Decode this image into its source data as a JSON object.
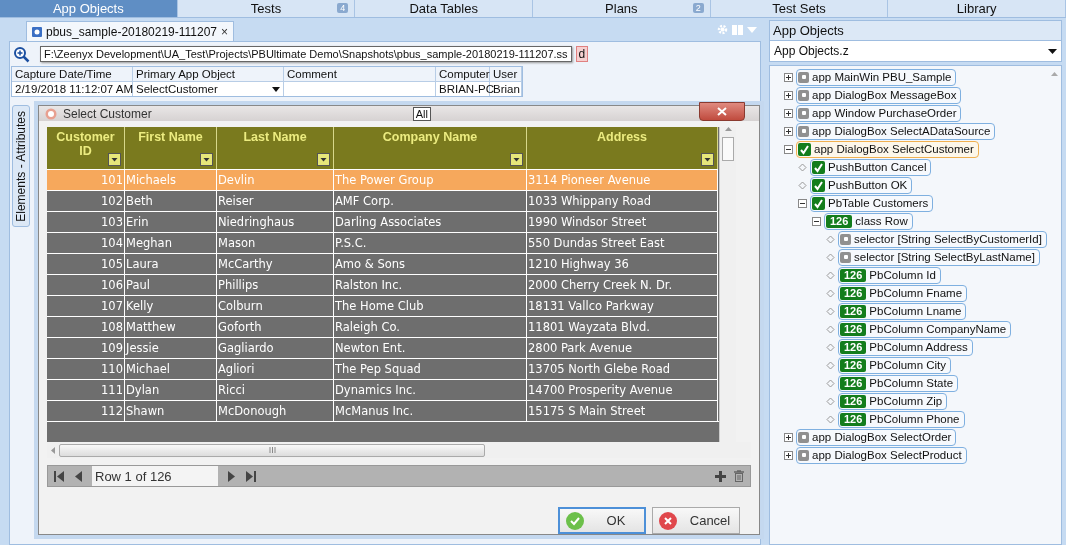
{
  "top_tabs": [
    {
      "label": "App Objects",
      "selected": true
    },
    {
      "label": "Tests",
      "badge": "4",
      "selected": false
    },
    {
      "label": "Data Tables",
      "selected": false
    },
    {
      "label": "Plans",
      "badge": "2",
      "selected": false
    },
    {
      "label": "Test Sets",
      "selected": false
    },
    {
      "label": "Library",
      "selected": false
    }
  ],
  "document_tab": {
    "title": "pbus_sample-20180219-111207",
    "close": "×"
  },
  "toolbar": {
    "fragment": "d"
  },
  "tooltip": "F:\\Zeenyx Development\\UA_Test\\Projects\\PBUltimate Demo\\Snapshots\\pbus_sample-20180219-111207.ss",
  "snapshot_info": {
    "columns": [
      "Capture Date/Time",
      "Primary App Object",
      "Comment",
      "Computer",
      "User"
    ],
    "values": {
      "capture_date_time": "2/19/2018 11:12:07 AM",
      "primary_app_object": "SelectCustomer",
      "computer": "BRIAN-PC",
      "user": "Brian"
    }
  },
  "side_tab": "Elements - Attributes",
  "dialog": {
    "title": "Select Customer",
    "filter_chip": "All",
    "columns": [
      "Customer ID",
      "First Name",
      "Last Name",
      "Company Name",
      "Address"
    ],
    "rows": [
      {
        "cells": [
          "101",
          "Michaels",
          "Devlin",
          "The Power Group",
          "3114 Pioneer Avenue"
        ],
        "selected": true
      },
      {
        "cells": [
          "102",
          "Beth",
          "Reiser",
          "AMF Corp.",
          "1033 Whippany Road"
        ],
        "selected": false
      },
      {
        "cells": [
          "103",
          "Erin",
          "Niedringhaus",
          "Darling Associates",
          "1990 Windsor Street"
        ],
        "selected": false
      },
      {
        "cells": [
          "104",
          "Meghan",
          "Mason",
          "P.S.C.",
          "550 Dundas Street East"
        ],
        "selected": false
      },
      {
        "cells": [
          "105",
          "Laura",
          "McCarthy",
          "Amo & Sons",
          "1210 Highway 36"
        ],
        "selected": false
      },
      {
        "cells": [
          "106",
          "Paul",
          "Phillips",
          "Ralston Inc.",
          "2000 Cherry Creek N. Dr."
        ],
        "selected": false
      },
      {
        "cells": [
          "107",
          "Kelly",
          "Colburn",
          "The Home Club",
          "18131 Vallco Parkway"
        ],
        "selected": false
      },
      {
        "cells": [
          "108",
          "Matthew",
          "Goforth",
          "Raleigh Co.",
          "11801 Wayzata Blvd."
        ],
        "selected": false
      },
      {
        "cells": [
          "109",
          "Jessie",
          "Gagliardo",
          "Newton Ent.",
          "2800 Park Avenue"
        ],
        "selected": false
      },
      {
        "cells": [
          "110",
          "Michael",
          "Agliori",
          "The Pep Squad",
          "13705 North Glebe Road"
        ],
        "selected": false
      },
      {
        "cells": [
          "111",
          "Dylan",
          "Ricci",
          "Dynamics Inc.",
          "14700 Prosperity Avenue"
        ],
        "selected": false
      },
      {
        "cells": [
          "112",
          "Shawn",
          "McDonough",
          "McManus Inc.",
          "15175 S Main Street"
        ],
        "selected": false
      }
    ],
    "row_indicator": "Row 1 of 126",
    "buttons": [
      {
        "label": "OK",
        "kind": "ok",
        "focused": true
      },
      {
        "label": "Cancel",
        "kind": "cancel",
        "focused": false
      }
    ]
  },
  "app_objects": {
    "title": "App Objects",
    "file": "App Objects.z",
    "tree": [
      {
        "label": "app MainWin PBU_Sample",
        "kind": "object",
        "expanded": false,
        "selected": false
      },
      {
        "label": "app DialogBox MessageBox",
        "kind": "object",
        "expanded": false,
        "selected": false
      },
      {
        "label": "app Window PurchaseOrder",
        "kind": "object",
        "expanded": false,
        "selected": false
      },
      {
        "label": "app DialogBox SelectADataSource",
        "kind": "object",
        "expanded": false,
        "selected": false
      },
      {
        "label": "app DialogBox SelectCustomer",
        "kind": "checked",
        "expanded": true,
        "selected": true,
        "children": [
          {
            "label": "PushButton Cancel",
            "kind": "checked",
            "selected": false
          },
          {
            "label": "PushButton OK",
            "kind": "checked",
            "selected": false
          },
          {
            "label": "PbTable Customers",
            "kind": "checked",
            "expanded": true,
            "selected": false,
            "children": [
              {
                "label": "class Row",
                "kind": "count",
                "count": "126",
                "expanded": true,
                "selected": false,
                "children": [
                  {
                    "label": "selector [String SelectByCustomerId]",
                    "kind": "object",
                    "selected": false
                  },
                  {
                    "label": "selector [String SelectByLastName]",
                    "kind": "object",
                    "selected": false
                  },
                  {
                    "label": "PbColumn Id",
                    "kind": "count",
                    "count": "126",
                    "selected": false
                  },
                  {
                    "label": "PbColumn Fname",
                    "kind": "count",
                    "count": "126",
                    "selected": false
                  },
                  {
                    "label": "PbColumn Lname",
                    "kind": "count",
                    "count": "126",
                    "selected": false
                  },
                  {
                    "label": "PbColumn CompanyName",
                    "kind": "count",
                    "count": "126",
                    "selected": false
                  },
                  {
                    "label": "PbColumn Address",
                    "kind": "count",
                    "count": "126",
                    "selected": false
                  },
                  {
                    "label": "PbColumn City",
                    "kind": "count",
                    "count": "126",
                    "selected": false
                  },
                  {
                    "label": "PbColumn State",
                    "kind": "count",
                    "count": "126",
                    "selected": false
                  },
                  {
                    "label": "PbColumn Zip",
                    "kind": "count",
                    "count": "126",
                    "selected": false
                  },
                  {
                    "label": "PbColumn Phone",
                    "kind": "count",
                    "count": "126",
                    "selected": false
                  }
                ]
              }
            ]
          }
        ]
      },
      {
        "label": "app DialogBox SelectOrder",
        "kind": "object",
        "expanded": false,
        "selected": false
      },
      {
        "label": "app DialogBox SelectProduct",
        "kind": "object",
        "expanded": false,
        "selected": false
      }
    ]
  }
}
